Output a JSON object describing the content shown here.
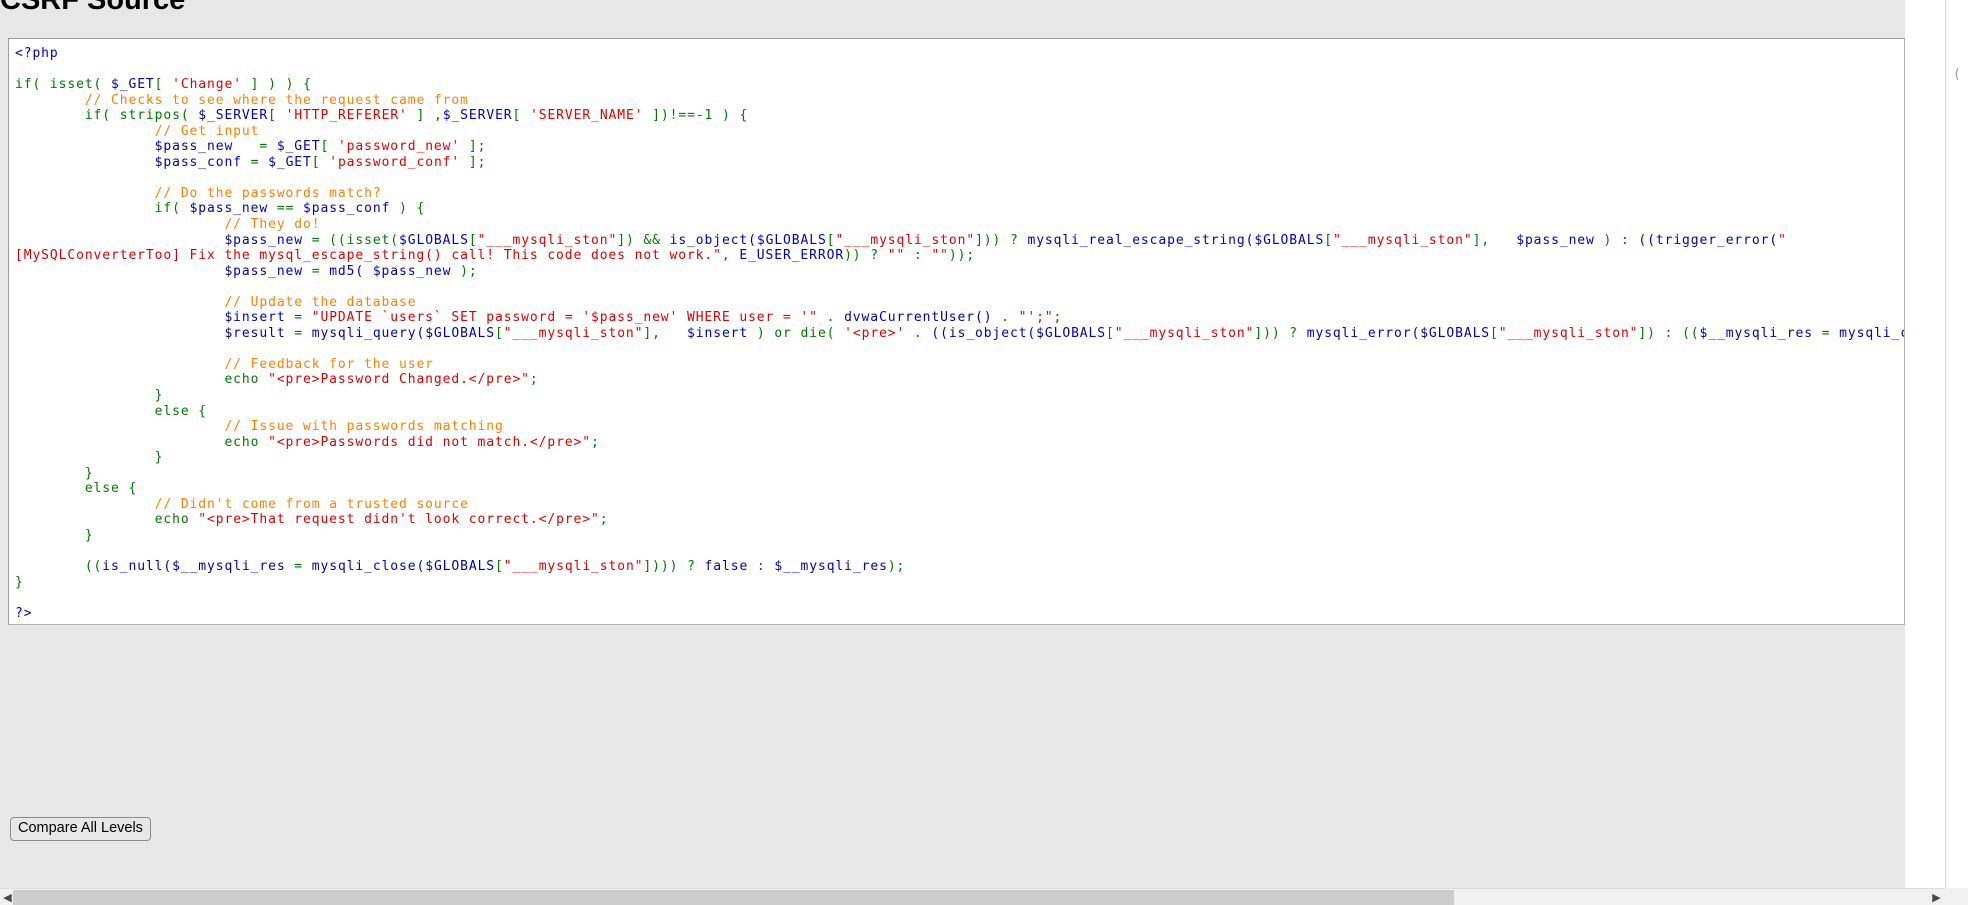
{
  "page": {
    "title": "CSRF Source",
    "language": "php"
  },
  "code": {
    "lines": [
      [
        {
          "t": "<?php",
          "c": "c-default"
        }
      ],
      [
        {
          "t": "",
          "c": "c-default"
        }
      ],
      [
        {
          "t": "if( ",
          "c": "c-keyword"
        },
        {
          "t": "isset( ",
          "c": "c-keyword"
        },
        {
          "t": "$_GET",
          "c": "c-default"
        },
        {
          "t": "[ ",
          "c": "c-keyword"
        },
        {
          "t": "'Change'",
          "c": "c-string"
        },
        {
          "t": " ] ",
          "c": "c-keyword"
        },
        {
          "t": ") ",
          "c": "c-keyword"
        },
        {
          "t": ") ",
          "c": "c-keyword"
        },
        {
          "t": "{",
          "c": "c-keyword"
        }
      ],
      [
        {
          "t": "        ",
          "c": "c-default"
        },
        {
          "t": "// Checks to see where the request came from",
          "c": "c-comment"
        }
      ],
      [
        {
          "t": "        ",
          "c": "c-default"
        },
        {
          "t": "if( ",
          "c": "c-keyword"
        },
        {
          "t": "stripos( ",
          "c": "c-keyword"
        },
        {
          "t": "$_SERVER",
          "c": "c-default"
        },
        {
          "t": "[ ",
          "c": "c-keyword"
        },
        {
          "t": "'HTTP_REFERER'",
          "c": "c-string"
        },
        {
          "t": " ] ,",
          "c": "c-keyword"
        },
        {
          "t": "$_SERVER",
          "c": "c-default"
        },
        {
          "t": "[ ",
          "c": "c-keyword"
        },
        {
          "t": "'SERVER_NAME'",
          "c": "c-string"
        },
        {
          "t": " ])!==-1 ) {",
          "c": "c-keyword"
        }
      ],
      [
        {
          "t": "                ",
          "c": "c-default"
        },
        {
          "t": "// Get input",
          "c": "c-comment"
        }
      ],
      [
        {
          "t": "                ",
          "c": "c-default"
        },
        {
          "t": "$pass_new",
          "c": "c-default"
        },
        {
          "t": "   = ",
          "c": "c-keyword"
        },
        {
          "t": "$_GET",
          "c": "c-default"
        },
        {
          "t": "[ ",
          "c": "c-keyword"
        },
        {
          "t": "'password_new'",
          "c": "c-string"
        },
        {
          "t": " ];",
          "c": "c-keyword"
        }
      ],
      [
        {
          "t": "                ",
          "c": "c-default"
        },
        {
          "t": "$pass_conf",
          "c": "c-default"
        },
        {
          "t": " = ",
          "c": "c-keyword"
        },
        {
          "t": "$_GET",
          "c": "c-default"
        },
        {
          "t": "[ ",
          "c": "c-keyword"
        },
        {
          "t": "'password_conf'",
          "c": "c-string"
        },
        {
          "t": " ];",
          "c": "c-keyword"
        }
      ],
      [
        {
          "t": "",
          "c": "c-default"
        }
      ],
      [
        {
          "t": "                ",
          "c": "c-default"
        },
        {
          "t": "// Do the passwords match?",
          "c": "c-comment"
        }
      ],
      [
        {
          "t": "                ",
          "c": "c-default"
        },
        {
          "t": "if( ",
          "c": "c-keyword"
        },
        {
          "t": "$pass_new",
          "c": "c-default"
        },
        {
          "t": " == ",
          "c": "c-keyword"
        },
        {
          "t": "$pass_conf",
          "c": "c-default"
        },
        {
          "t": " ) {",
          "c": "c-keyword"
        }
      ],
      [
        {
          "t": "                        ",
          "c": "c-default"
        },
        {
          "t": "// They do!",
          "c": "c-comment"
        }
      ],
      [
        {
          "t": "                        ",
          "c": "c-default"
        },
        {
          "t": "$pass_new",
          "c": "c-default"
        },
        {
          "t": " = ((",
          "c": "c-keyword"
        },
        {
          "t": "isset(",
          "c": "c-keyword"
        },
        {
          "t": "$GLOBALS",
          "c": "c-default"
        },
        {
          "t": "[",
          "c": "c-keyword"
        },
        {
          "t": "\"___mysqli_ston\"",
          "c": "c-string"
        },
        {
          "t": "]) ",
          "c": "c-keyword"
        },
        {
          "t": "&&",
          "c": "c-keyword"
        },
        {
          "t": " is_object(",
          "c": "c-default"
        },
        {
          "t": "$GLOBALS",
          "c": "c-default"
        },
        {
          "t": "[",
          "c": "c-keyword"
        },
        {
          "t": "\"___mysqli_ston\"",
          "c": "c-string"
        },
        {
          "t": "])) ",
          "c": "c-keyword"
        },
        {
          "t": "? ",
          "c": "c-keyword"
        },
        {
          "t": "mysqli_real_escape_string(",
          "c": "c-default"
        },
        {
          "t": "$GLOBALS",
          "c": "c-default"
        },
        {
          "t": "[",
          "c": "c-keyword"
        },
        {
          "t": "\"___mysqli_ston\"",
          "c": "c-string"
        },
        {
          "t": "],   ",
          "c": "c-keyword"
        },
        {
          "t": "$pass_new",
          "c": "c-default"
        },
        {
          "t": " ) ",
          "c": "c-keyword"
        },
        {
          "t": ": ",
          "c": "c-keyword"
        },
        {
          "t": "((trigger_error(",
          "c": "c-default"
        },
        {
          "t": "\"",
          "c": "c-string"
        }
      ],
      [
        {
          "t": "[MySQLConverterToo]",
          "c": "c-string"
        },
        {
          "t": " Fix the mysql_escape_string() call! This code does not work.\"",
          "c": "c-string"
        },
        {
          "t": ", ",
          "c": "c-keyword"
        },
        {
          "t": "E_USER_ERROR",
          "c": "c-default"
        },
        {
          "t": ")) ",
          "c": "c-keyword"
        },
        {
          "t": "? ",
          "c": "c-keyword"
        },
        {
          "t": "\"\"",
          "c": "c-string"
        },
        {
          "t": " : ",
          "c": "c-keyword"
        },
        {
          "t": "\"\"",
          "c": "c-string"
        },
        {
          "t": "));",
          "c": "c-keyword"
        }
      ],
      [
        {
          "t": "                        ",
          "c": "c-default"
        },
        {
          "t": "$pass_new",
          "c": "c-default"
        },
        {
          "t": " = ",
          "c": "c-keyword"
        },
        {
          "t": "md5( ",
          "c": "c-default"
        },
        {
          "t": "$pass_new",
          "c": "c-default"
        },
        {
          "t": " );",
          "c": "c-keyword"
        }
      ],
      [
        {
          "t": "",
          "c": "c-default"
        }
      ],
      [
        {
          "t": "                        ",
          "c": "c-default"
        },
        {
          "t": "// Update the database",
          "c": "c-comment"
        }
      ],
      [
        {
          "t": "                        ",
          "c": "c-default"
        },
        {
          "t": "$insert",
          "c": "c-default"
        },
        {
          "t": " = ",
          "c": "c-keyword"
        },
        {
          "t": "\"UPDATE `users` SET password = '$pass_new' WHERE user = '\"",
          "c": "c-string"
        },
        {
          "t": " . ",
          "c": "c-keyword"
        },
        {
          "t": "dvwaCurrentUser()",
          "c": "c-default"
        },
        {
          "t": " . ",
          "c": "c-keyword"
        },
        {
          "t": "\"';\"",
          "c": "c-string"
        },
        {
          "t": ";",
          "c": "c-keyword"
        }
      ],
      [
        {
          "t": "                        ",
          "c": "c-default"
        },
        {
          "t": "$result",
          "c": "c-default"
        },
        {
          "t": " = ",
          "c": "c-keyword"
        },
        {
          "t": "mysqli_query(",
          "c": "c-default"
        },
        {
          "t": "$GLOBALS",
          "c": "c-default"
        },
        {
          "t": "[",
          "c": "c-keyword"
        },
        {
          "t": "\"___mysqli_ston\"",
          "c": "c-string"
        },
        {
          "t": "],   ",
          "c": "c-keyword"
        },
        {
          "t": "$insert",
          "c": "c-default"
        },
        {
          "t": " ) ",
          "c": "c-keyword"
        },
        {
          "t": "or ",
          "c": "c-keyword"
        },
        {
          "t": "die( ",
          "c": "c-keyword"
        },
        {
          "t": "'<pre>'",
          "c": "c-string"
        },
        {
          "t": " . ",
          "c": "c-keyword"
        },
        {
          "t": "((is_object(",
          "c": "c-default"
        },
        {
          "t": "$GLOBALS",
          "c": "c-default"
        },
        {
          "t": "[",
          "c": "c-keyword"
        },
        {
          "t": "\"___mysqli_ston\"",
          "c": "c-string"
        },
        {
          "t": "])) ",
          "c": "c-keyword"
        },
        {
          "t": "? ",
          "c": "c-keyword"
        },
        {
          "t": "mysqli_error(",
          "c": "c-default"
        },
        {
          "t": "$GLOBALS",
          "c": "c-default"
        },
        {
          "t": "[",
          "c": "c-keyword"
        },
        {
          "t": "\"___mysqli_ston\"",
          "c": "c-string"
        },
        {
          "t": "]) ",
          "c": "c-keyword"
        },
        {
          "t": ": ",
          "c": "c-keyword"
        },
        {
          "t": "((",
          "c": "c-keyword"
        },
        {
          "t": "$__mysqli_res",
          "c": "c-default"
        },
        {
          "t": " = ",
          "c": "c-keyword"
        },
        {
          "t": "mysqli_connec",
          "c": "c-default"
        }
      ],
      [
        {
          "t": "",
          "c": "c-default"
        }
      ],
      [
        {
          "t": "                        ",
          "c": "c-default"
        },
        {
          "t": "// Feedback for the user",
          "c": "c-comment"
        }
      ],
      [
        {
          "t": "                        ",
          "c": "c-default"
        },
        {
          "t": "echo ",
          "c": "c-keyword"
        },
        {
          "t": "\"<pre>Password Changed.</pre>\"",
          "c": "c-string"
        },
        {
          "t": ";",
          "c": "c-keyword"
        }
      ],
      [
        {
          "t": "                ",
          "c": "c-default"
        },
        {
          "t": "}",
          "c": "c-keyword"
        }
      ],
      [
        {
          "t": "                ",
          "c": "c-default"
        },
        {
          "t": "else ",
          "c": "c-keyword"
        },
        {
          "t": "{",
          "c": "c-keyword"
        }
      ],
      [
        {
          "t": "                        ",
          "c": "c-default"
        },
        {
          "t": "// Issue with passwords matching",
          "c": "c-comment"
        }
      ],
      [
        {
          "t": "                        ",
          "c": "c-default"
        },
        {
          "t": "echo ",
          "c": "c-keyword"
        },
        {
          "t": "\"<pre>Passwords did not match.</pre>\"",
          "c": "c-string"
        },
        {
          "t": ";",
          "c": "c-keyword"
        }
      ],
      [
        {
          "t": "                ",
          "c": "c-default"
        },
        {
          "t": "}",
          "c": "c-keyword"
        }
      ],
      [
        {
          "t": "        ",
          "c": "c-default"
        },
        {
          "t": "}",
          "c": "c-keyword"
        }
      ],
      [
        {
          "t": "        ",
          "c": "c-default"
        },
        {
          "t": "else ",
          "c": "c-keyword"
        },
        {
          "t": "{",
          "c": "c-keyword"
        }
      ],
      [
        {
          "t": "                ",
          "c": "c-default"
        },
        {
          "t": "// Didn't come from a trusted source",
          "c": "c-comment"
        }
      ],
      [
        {
          "t": "                ",
          "c": "c-default"
        },
        {
          "t": "echo ",
          "c": "c-keyword"
        },
        {
          "t": "\"<pre>That request didn't look correct.</pre>\"",
          "c": "c-string"
        },
        {
          "t": ";",
          "c": "c-keyword"
        }
      ],
      [
        {
          "t": "        ",
          "c": "c-default"
        },
        {
          "t": "}",
          "c": "c-keyword"
        }
      ],
      [
        {
          "t": "",
          "c": "c-default"
        }
      ],
      [
        {
          "t": "        ",
          "c": "c-default"
        },
        {
          "t": "((",
          "c": "c-keyword"
        },
        {
          "t": "is_null(",
          "c": "c-default"
        },
        {
          "t": "$__mysqli_res",
          "c": "c-default"
        },
        {
          "t": " = ",
          "c": "c-keyword"
        },
        {
          "t": "mysqli_close(",
          "c": "c-default"
        },
        {
          "t": "$GLOBALS",
          "c": "c-default"
        },
        {
          "t": "[",
          "c": "c-keyword"
        },
        {
          "t": "\"___mysqli_ston\"",
          "c": "c-string"
        },
        {
          "t": "]))) ",
          "c": "c-keyword"
        },
        {
          "t": "? ",
          "c": "c-keyword"
        },
        {
          "t": "false",
          "c": "c-default"
        },
        {
          "t": " : ",
          "c": "c-keyword"
        },
        {
          "t": "$__mysqli_res",
          "c": "c-default"
        },
        {
          "t": ");",
          "c": "c-keyword"
        }
      ],
      [
        {
          "t": "}",
          "c": "c-keyword"
        }
      ],
      [
        {
          "t": "",
          "c": "c-default"
        }
      ],
      [
        {
          "t": "?>",
          "c": "c-default"
        }
      ]
    ]
  },
  "toolbar": {
    "compare_label": "Compare All Levels"
  },
  "scrollbars": {
    "horizontal_left_arrow": "◀",
    "horizontal_right_arrow": "▶",
    "right_gutter_mark": "("
  },
  "colors": {
    "page_background": "#e7e7e7",
    "code_background": "#ffffff",
    "php_default": "#0000bb",
    "php_keyword": "#007700",
    "php_string": "#dd0000",
    "php_comment": "#ff8000",
    "scrollbar_thumb": "#cdcdcd"
  }
}
